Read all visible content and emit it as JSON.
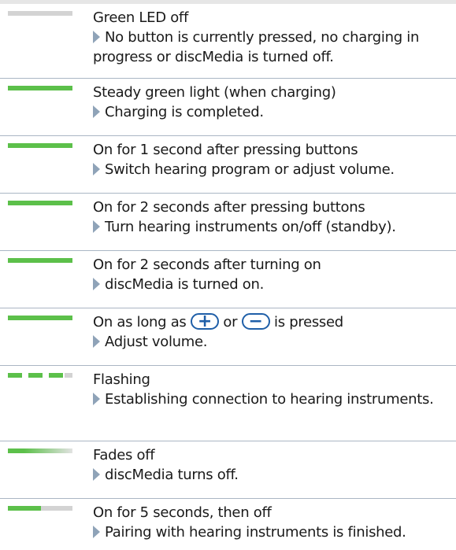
{
  "rows": [
    {
      "title": "Green LED off",
      "desc": "No button is currently pressed, no charging in progress or discMedia is turned off."
    },
    {
      "title": "Steady green light (when charging)",
      "desc": "Charging is completed."
    },
    {
      "title": "On for 1 second after pressing buttons",
      "desc": "Switch hearing program or adjust volume."
    },
    {
      "title": "On for 2 seconds after pressing buttons",
      "desc": "Turn hearing instruments on/off (standby)."
    },
    {
      "title": "On for 2 seconds after turning on",
      "desc": "discMedia is turned on."
    },
    {
      "title_prefix": "On as long as",
      "title_middle": "or",
      "title_suffix": "is pressed",
      "plus_symbol": "+",
      "minus_symbol": "−",
      "desc": "Adjust volume."
    },
    {
      "title": "Flashing",
      "desc": "Establishing connection to hearing instruments."
    },
    {
      "title": "Fades off",
      "desc": "discMedia turns off."
    },
    {
      "title": "On for 5 seconds, then off",
      "desc": "Pairing with hearing instruments is finished."
    }
  ],
  "led_states": [
    "off",
    "solid",
    "solid",
    "solid",
    "solid",
    "solid",
    "flash",
    "fade",
    "partial"
  ],
  "colors": {
    "led_green": "#5cc04a",
    "led_off": "#d3d3d3",
    "arrow": "#8fa3b8",
    "button_blue": "#1f5fa8",
    "divider": "#aab6c4"
  },
  "icons": {
    "arrow": "triangle-right-icon",
    "plus_button": "plus-button-icon",
    "minus_button": "minus-button-icon"
  }
}
